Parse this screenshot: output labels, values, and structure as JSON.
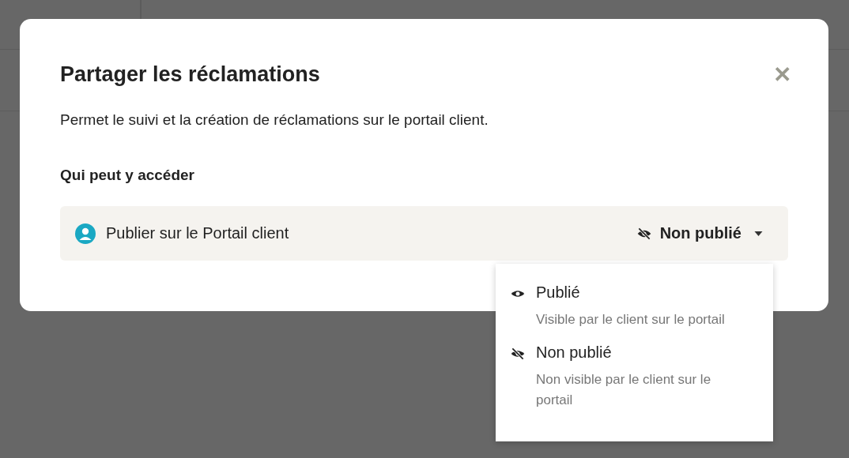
{
  "dialog": {
    "title": "Partager les réclamations",
    "close": "✕",
    "description": "Permet le suivi et la création de réclamations sur le portail client.",
    "section_label": "Qui peut y accéder",
    "setting": {
      "label": "Publier sur le Portail client",
      "value": {
        "text": "Non publié",
        "kind": "hidden"
      },
      "expanded": true
    }
  },
  "dropdown": [
    {
      "kind": "visible",
      "label": "Publié",
      "hint": "Visible par le client sur le portail"
    },
    {
      "kind": "hidden",
      "label": "Non publié",
      "hint": "Non visible par le client sur le portail"
    }
  ]
}
